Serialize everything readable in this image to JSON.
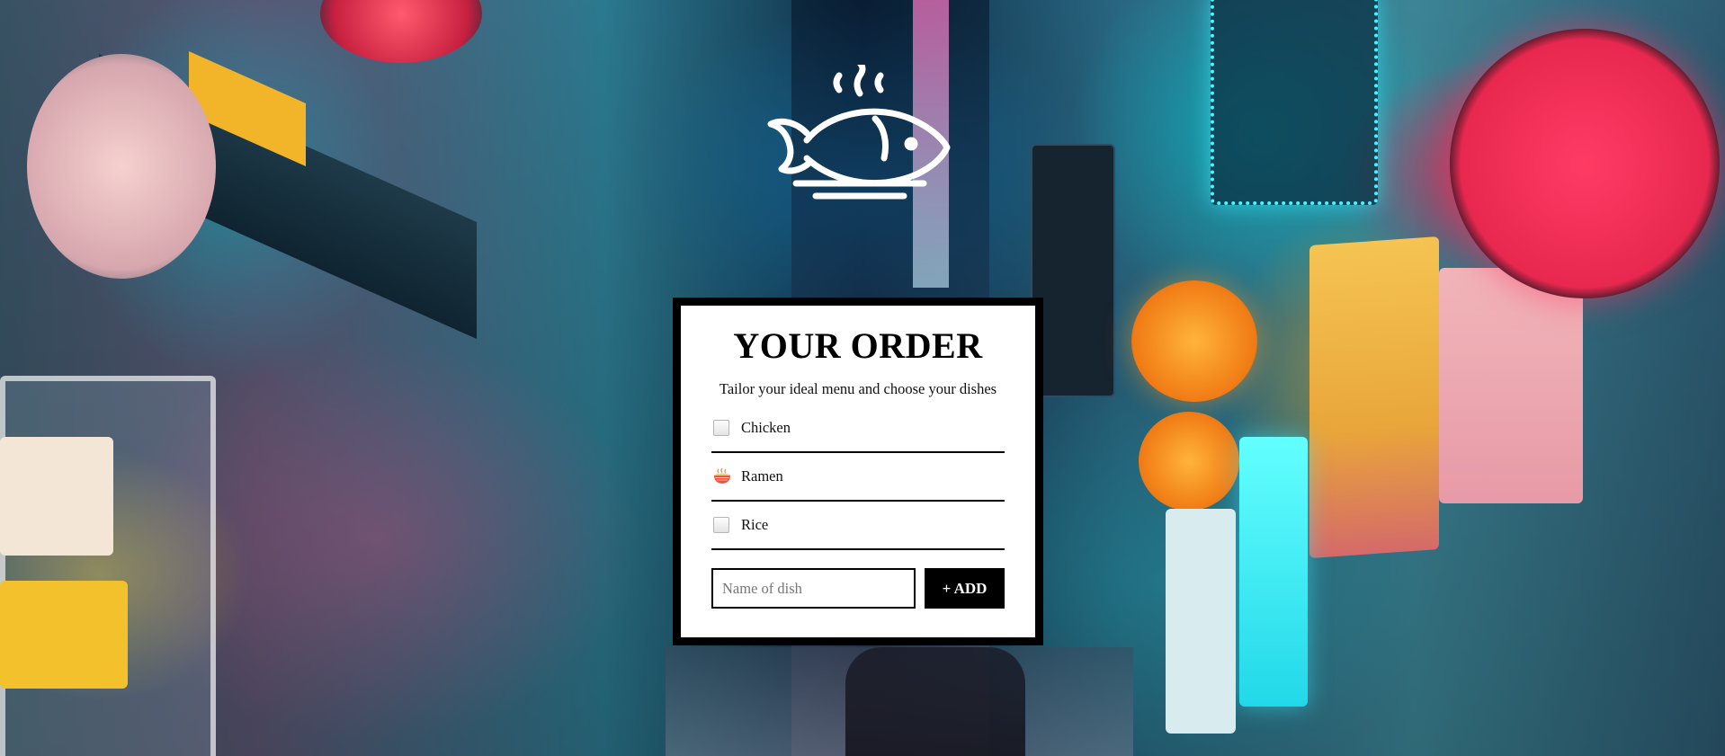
{
  "order": {
    "title": "YOUR ORDER",
    "subtitle": "Tailor your ideal menu and choose your dishes",
    "dishes": [
      {
        "label": "Chicken",
        "state": "unchecked"
      },
      {
        "label": "Ramen",
        "state": "checked-ramen-emoji"
      },
      {
        "label": "Rice",
        "state": "unchecked"
      }
    ],
    "input_placeholder": "Name of dish",
    "add_label": "+ ADD"
  },
  "logo": {
    "icon": "fish-plate-steam-icon",
    "color": "#ffffff"
  },
  "background": {
    "description_icon": "neon-street-photo"
  },
  "colors": {
    "card_border": "#000000",
    "button_bg": "#000000",
    "button_text": "#ffffff"
  }
}
